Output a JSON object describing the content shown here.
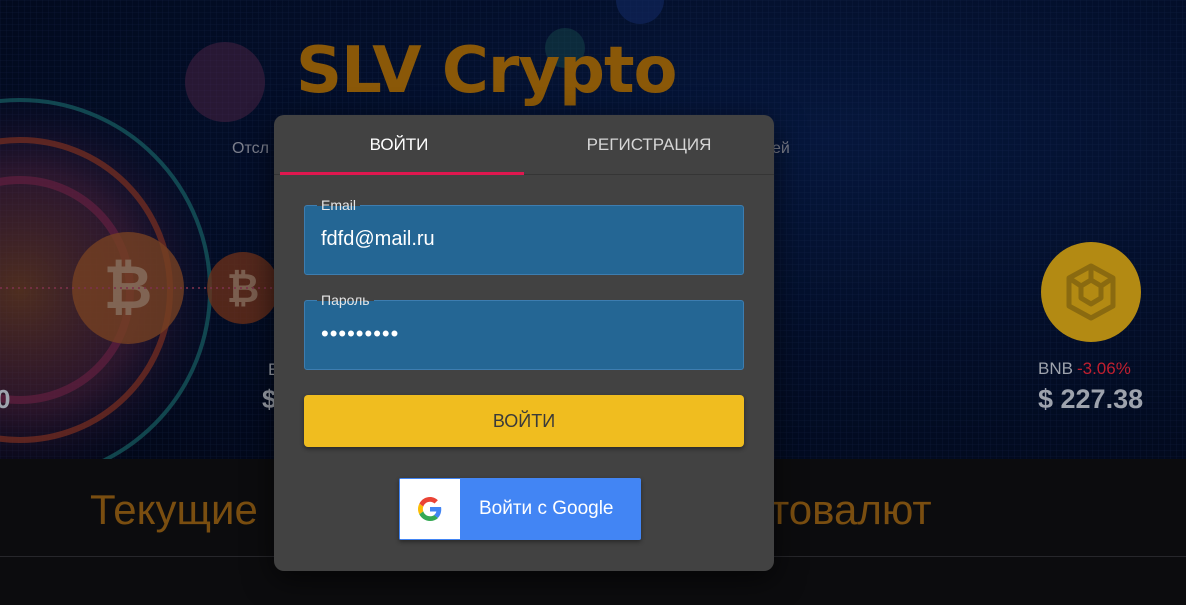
{
  "hero": {
    "title": "SLV Crypto",
    "subtitle_start": "Отсл",
    "subtitle_end": "ей"
  },
  "coins": {
    "left_value": "0",
    "middle_name": "E",
    "middle_value": "$",
    "bnb": {
      "name": "BNB",
      "change": "-3.06%",
      "price": "$ 227.38",
      "icon": "bnb-icon",
      "change_color": "#c01f2f"
    }
  },
  "section": {
    "heading_start": "Текущие",
    "heading_end": "товалют"
  },
  "modal": {
    "tabs": [
      {
        "label": "ВОЙТИ",
        "active": true
      },
      {
        "label": "РЕГИСТРАЦИЯ",
        "active": false
      }
    ],
    "email": {
      "label": "Email",
      "value": "fdfd@mail.ru"
    },
    "password": {
      "label": "Пароль",
      "value": "•••••••••"
    },
    "submit_label": "ВОЙТИ",
    "google": {
      "label": "Войти с Google",
      "icon": "google-icon"
    }
  },
  "colors": {
    "accent_tab": "#e0174f",
    "submit": "#f0bd1f",
    "field_bg": "#246694",
    "google_blue": "#4285f4",
    "title_gold": "#8a5808"
  }
}
